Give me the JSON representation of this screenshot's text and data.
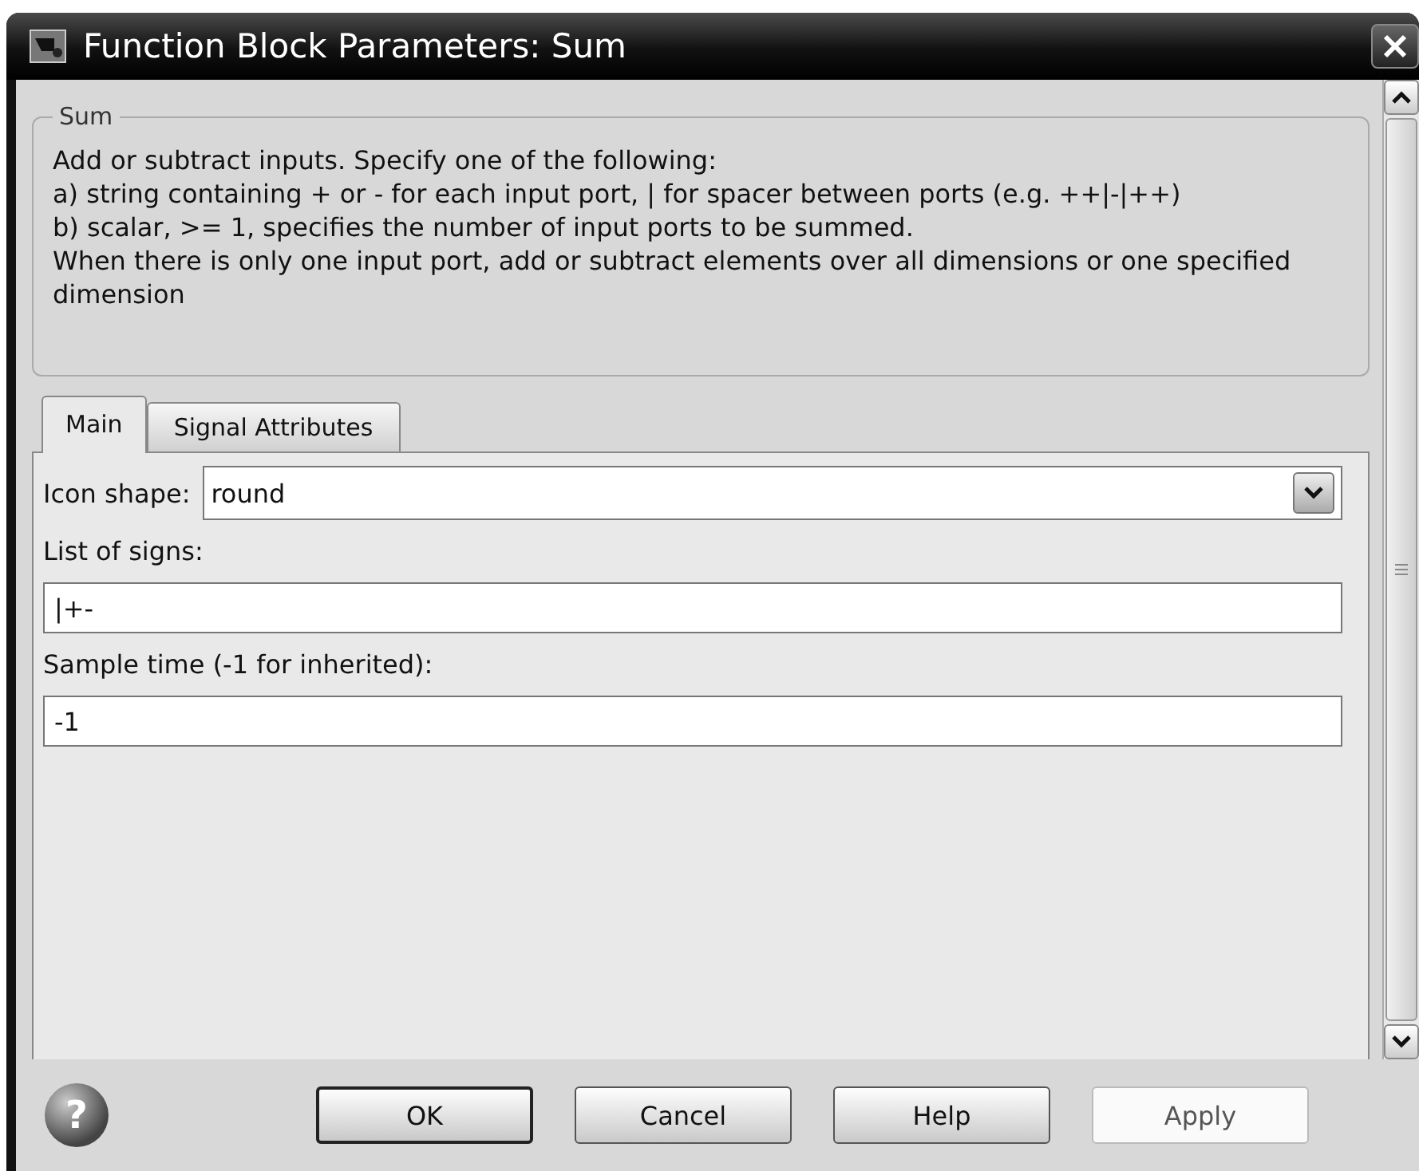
{
  "window": {
    "title": "Function Block Parameters: Sum"
  },
  "description": {
    "legend": "Sum",
    "lines": [
      "Add or subtract inputs.  Specify one of the following:",
      "a) string containing + or - for each input port, | for spacer between ports (e.g. ++|-|++)",
      "b) scalar, >= 1, specifies the number of input ports to be summed.",
      "When there is only one input port, add or subtract elements over all dimensions or one specified dimension"
    ]
  },
  "tabs": [
    {
      "label": "Main",
      "selected": true
    },
    {
      "label": "Signal Attributes",
      "selected": false
    }
  ],
  "parameters": [
    {
      "kind": "dropdown",
      "label": "Icon shape:",
      "value": "round"
    },
    {
      "kind": "text",
      "label": "List of signs:",
      "value": "|+-"
    },
    {
      "kind": "text",
      "label": "Sample time (-1 for inherited):",
      "value": "-1"
    }
  ],
  "help": {
    "glyph": "?"
  },
  "buttons": [
    {
      "label": "OK",
      "default": true,
      "disabled": false
    },
    {
      "label": "Cancel",
      "default": false,
      "disabled": false
    },
    {
      "label": "Help",
      "default": false,
      "disabled": false
    },
    {
      "label": "Apply",
      "default": false,
      "disabled": true
    }
  ]
}
